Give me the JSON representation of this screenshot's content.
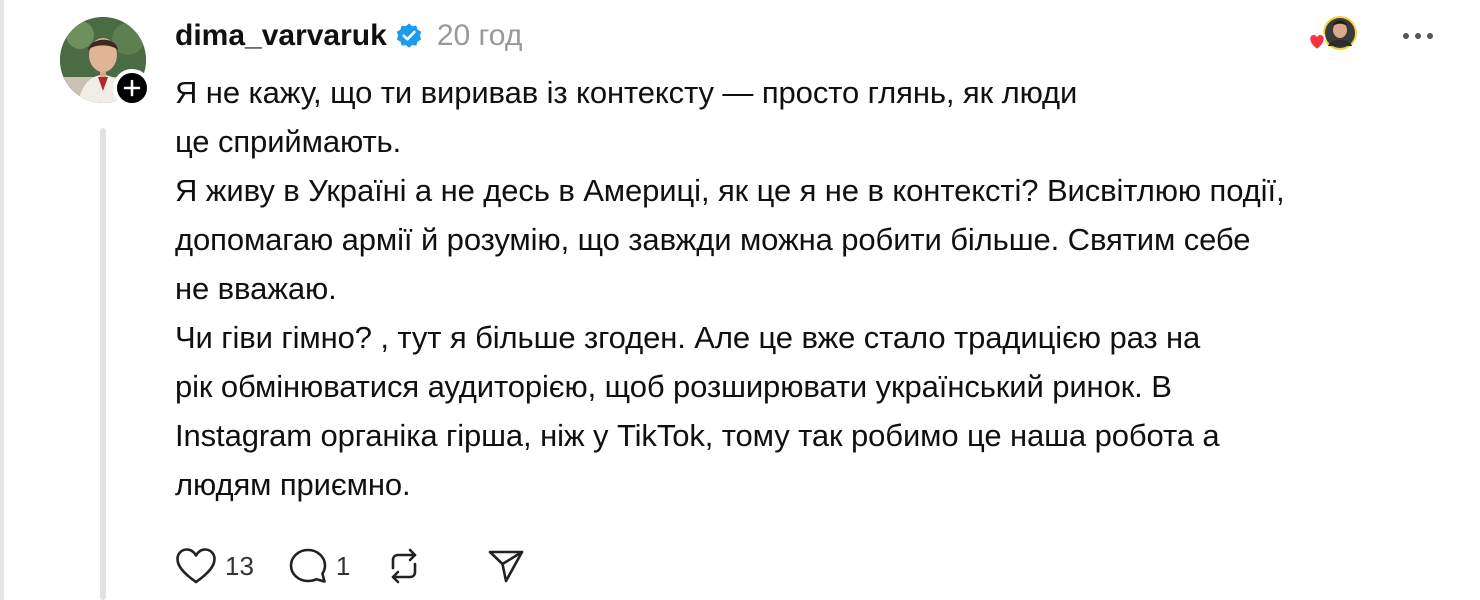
{
  "post": {
    "username": "dima_varvaruk",
    "verified_icon": "verified-badge-icon",
    "timestamp": "20 год",
    "text_lines": [
      "Я не кажу, що ти виривав із контексту — просто глянь, як люди",
      "це сприймають.",
      "Я живу в Україні а не десь в Америці, як це я не в контексті? Висвітлюю події,",
      "допомагаю армії й розумію, що завжди можна робити більше. Святим себе",
      "не вважаю.",
      "Чи гіви гімно? , тут я більше згоден. Але це вже стало традицією раз на",
      "рік обмінюватися аудиторією, щоб розширювати український ринок. В",
      "Instagram органіка гірша, ніж у TikTok, тому так робимо це наша робота а",
      "людям приємно."
    ],
    "likes_count": "13",
    "replies_count": "1"
  },
  "icons": {
    "like": "heart-icon",
    "reply": "comment-icon",
    "repost": "repost-icon",
    "share": "send-icon",
    "more": "more-icon",
    "follow": "plus-icon"
  },
  "colors": {
    "verified": "#1d9bf0",
    "heart": "#ff3040",
    "muted": "#999999",
    "text": "#101010"
  }
}
